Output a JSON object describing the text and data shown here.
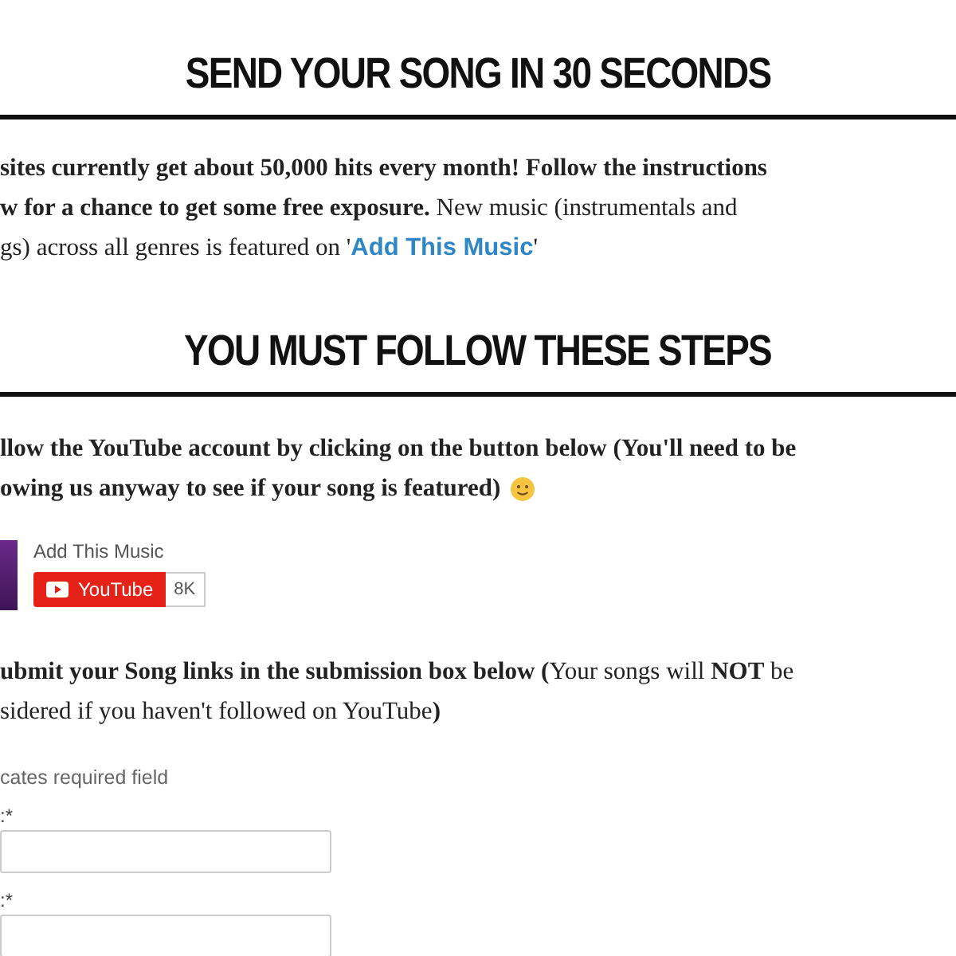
{
  "sections": [
    {
      "heading": "SEND YOUR SONG IN 30 SECONDS",
      "lines": [
        "**sites currently get about 50,000 hits every month! Follow the instructions**",
        "**w for a chance to get some free exposure.** New music (instrumentals and"
      ],
      "link_line": {
        "before": "gs) across all genres is featured on '",
        "link": "Add This Music",
        "after": "'"
      }
    },
    {
      "heading": "YOU MUST FOLLOW THESE STEPS"
    }
  ],
  "step1": {
    "lines": [
      "**llow the YouTube account by clicking on the button below (You'll need to be**",
      "**owing us anyway to see if your song is featured)**"
    ]
  },
  "channel": {
    "name": "Add This Music",
    "button": "YouTube",
    "count": "8K"
  },
  "step2": {
    "lines": [
      "**ubmit your Song links in the submission box below (**Your songs will **NOT** be",
      "sidered if you haven't followed on YouTube**)**"
    ]
  },
  "form": {
    "note": "cates required field",
    "fields": [
      {
        "label": ":*"
      },
      {
        "label": ":*"
      }
    ]
  }
}
